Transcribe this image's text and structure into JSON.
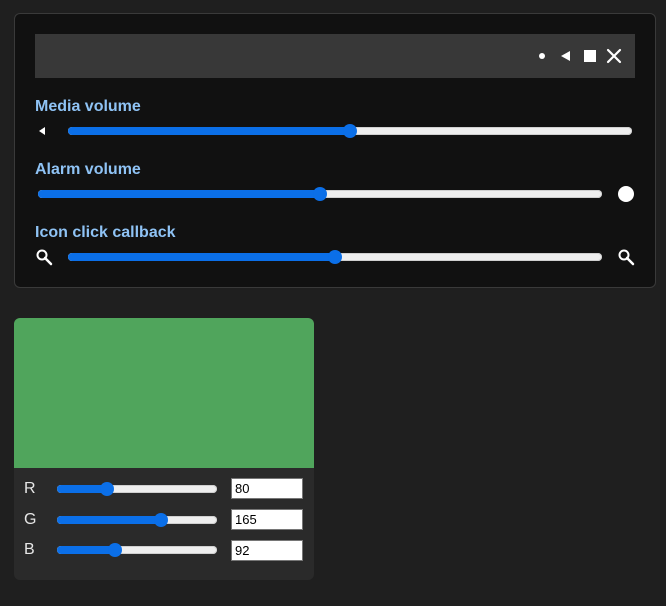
{
  "toolbar": {
    "icons": [
      "dot-icon",
      "back-triangle-icon",
      "stop-square-icon",
      "close-icon"
    ]
  },
  "sliders": [
    {
      "label": "Media volume",
      "value": 0.5,
      "start_icon": "back-triangle-icon"
    },
    {
      "label": "Alarm volume",
      "value": 0.5,
      "end_icon": "circle-icon"
    },
    {
      "label": "Icon click callback",
      "value": 0.5,
      "start_icon": "zoom-out-icon",
      "end_icon": "zoom-in-icon"
    }
  ],
  "color_picker": {
    "color": "#50a55c",
    "channels": [
      {
        "label": "R",
        "value": "80"
      },
      {
        "label": "G",
        "value": "165"
      },
      {
        "label": "B",
        "value": "92"
      }
    ]
  },
  "colors": {
    "accent": "#0b6fe8",
    "label": "#8fc3f5"
  }
}
